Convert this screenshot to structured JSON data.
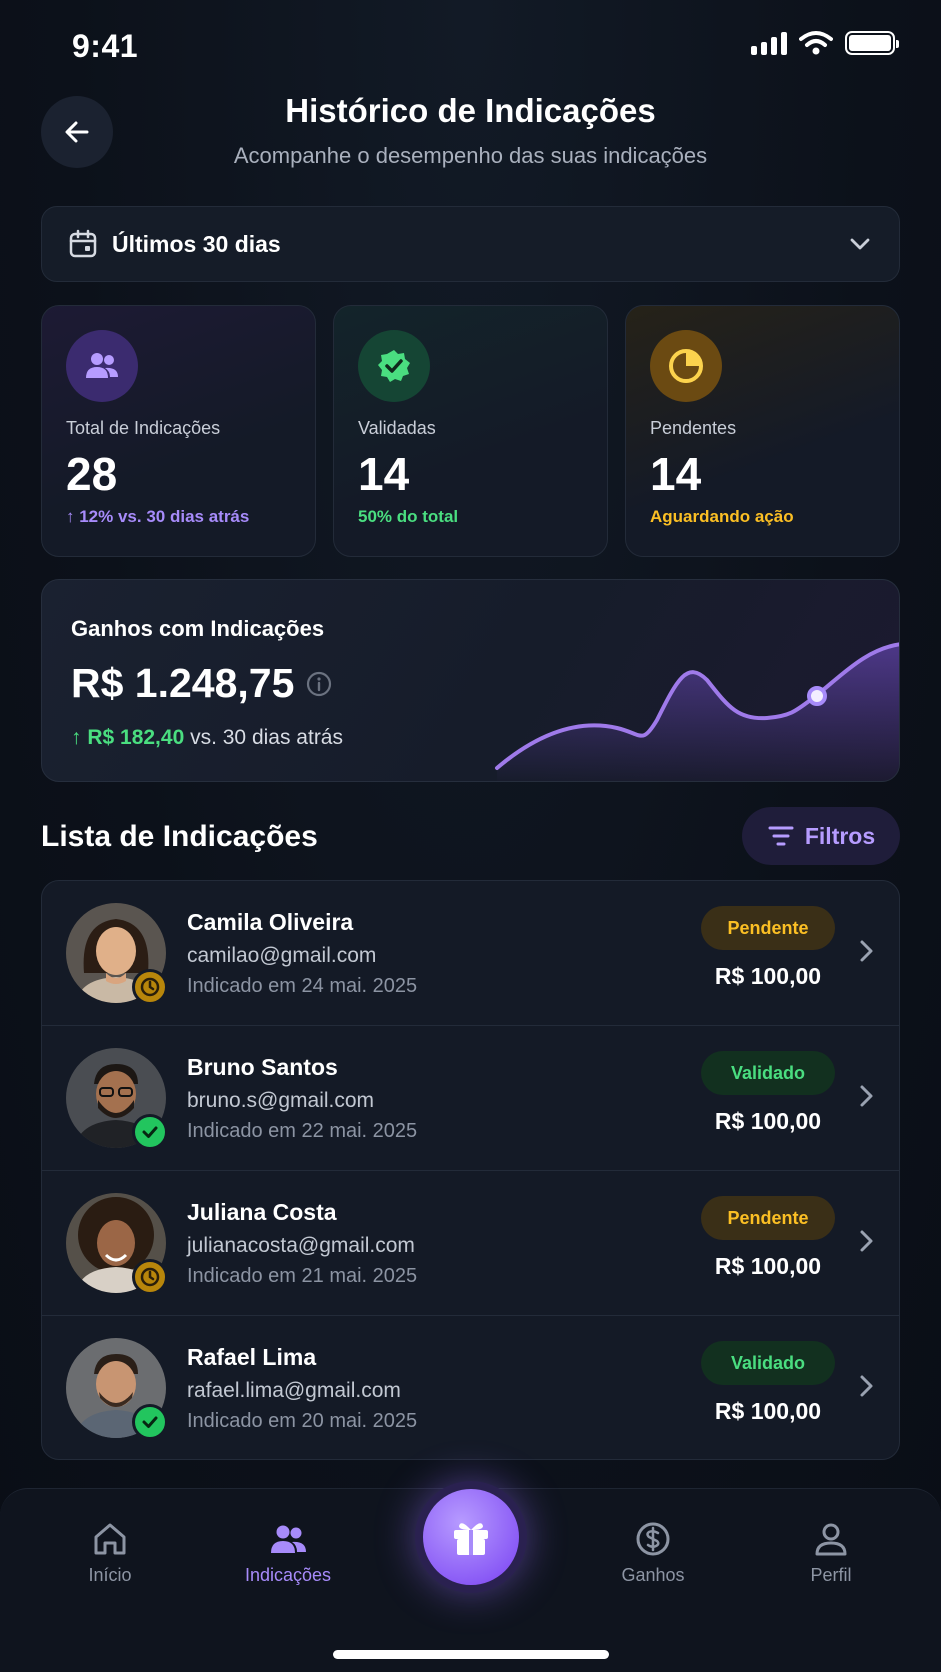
{
  "status_bar": {
    "time": "9:41"
  },
  "header": {
    "title": "Histórico de Indicações",
    "subtitle": "Acompanhe o desempenho das suas indicações"
  },
  "period": {
    "label": "Últimos 30 dias"
  },
  "stats": [
    {
      "label": "Total de Indicações",
      "value": "28",
      "foot": "↑ 12% vs. 30 dias atrás",
      "icon": "users-icon",
      "color": "#a78bfa"
    },
    {
      "label": "Validadas",
      "value": "14",
      "foot": "50% do total",
      "icon": "verified-badge-icon",
      "color": "#4ade80"
    },
    {
      "label": "Pendentes",
      "value": "14",
      "foot": "Aguardando ação",
      "icon": "pie-clock-icon",
      "color": "#fbbf24"
    }
  ],
  "earnings": {
    "title": "Ganhos com Indicações",
    "value": "R$ 1.248,75",
    "delta_value": "↑ R$ 182,40",
    "delta_text": " vs. 30 dias atrás"
  },
  "list": {
    "title": "Lista de Indicações",
    "filter_label": "Filtros",
    "items": [
      {
        "name": "Camila Oliveira",
        "email": "camilao@gmail.com",
        "date": "Indicado em 24 mai. 2025",
        "status": "Pendente",
        "amount": "R$ 100,00"
      },
      {
        "name": "Bruno Santos",
        "email": "bruno.s@gmail.com",
        "date": "Indicado em 22 mai. 2025",
        "status": "Validado",
        "amount": "R$ 100,00"
      },
      {
        "name": "Juliana Costa",
        "email": "julianacosta@gmail.com",
        "date": "Indicado em 21 mai. 2025",
        "status": "Pendente",
        "amount": "R$ 100,00"
      },
      {
        "name": "Rafael Lima",
        "email": "rafael.lima@gmail.com",
        "date": "Indicado em 20 mai. 2025",
        "status": "Validado",
        "amount": "R$ 100,00"
      }
    ]
  },
  "nav": {
    "items": [
      {
        "label": "Início",
        "icon": "home-icon"
      },
      {
        "label": "Indicações",
        "icon": "users-icon",
        "active": true
      },
      {
        "label": "Ganhos",
        "icon": "dollar-circle-icon"
      },
      {
        "label": "Perfil",
        "icon": "user-icon"
      }
    ],
    "center_icon": "gift-icon"
  },
  "colors": {
    "accent": "#a78bfa",
    "success": "#4ade80",
    "warning": "#fbbf24",
    "background": "#0d121b"
  }
}
